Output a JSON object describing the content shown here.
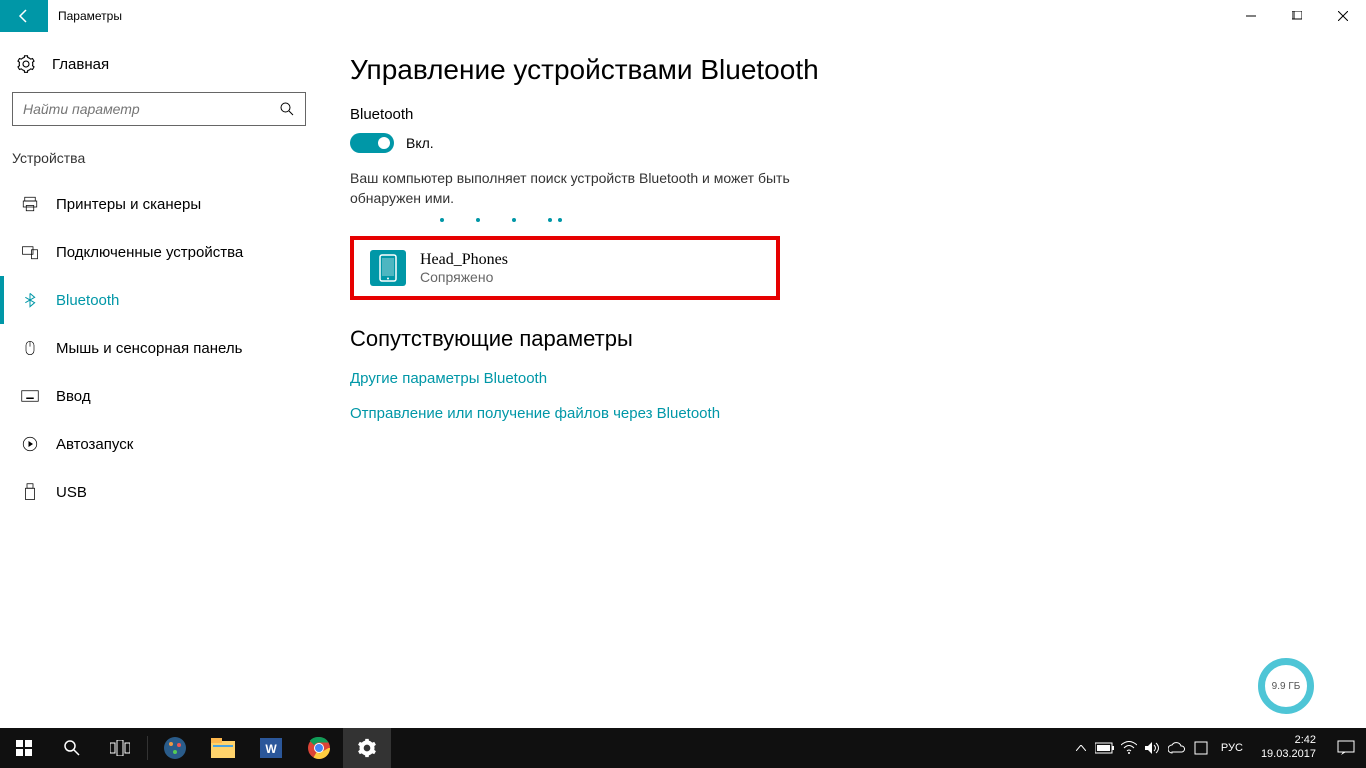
{
  "titlebar": {
    "label": "Параметры"
  },
  "home": {
    "label": "Главная"
  },
  "search": {
    "placeholder": "Найти параметр"
  },
  "group": {
    "label": "Устройства"
  },
  "nav": {
    "items": [
      {
        "label": "Принтеры и сканеры"
      },
      {
        "label": "Подключенные устройства"
      },
      {
        "label": "Bluetooth"
      },
      {
        "label": "Мышь и сенсорная панель"
      },
      {
        "label": "Ввод"
      },
      {
        "label": "Автозапуск"
      },
      {
        "label": "USB"
      }
    ]
  },
  "main": {
    "heading": "Управление устройствами Bluetooth",
    "section_label": "Bluetooth",
    "toggle_state": "Вкл.",
    "status_text": "Ваш компьютер выполняет поиск устройств Bluetooth и может быть обнаружен ими."
  },
  "device": {
    "name": "Head_Phones",
    "status": "Сопряжено"
  },
  "related": {
    "heading": "Сопутствующие параметры",
    "link1": "Другие параметры Bluetooth",
    "link2": "Отправление или получение файлов через Bluetooth"
  },
  "indicator": {
    "label": "9.9 ГБ"
  },
  "tray": {
    "lang": "РУС",
    "time": "2:42",
    "date": "19.03.2017"
  }
}
